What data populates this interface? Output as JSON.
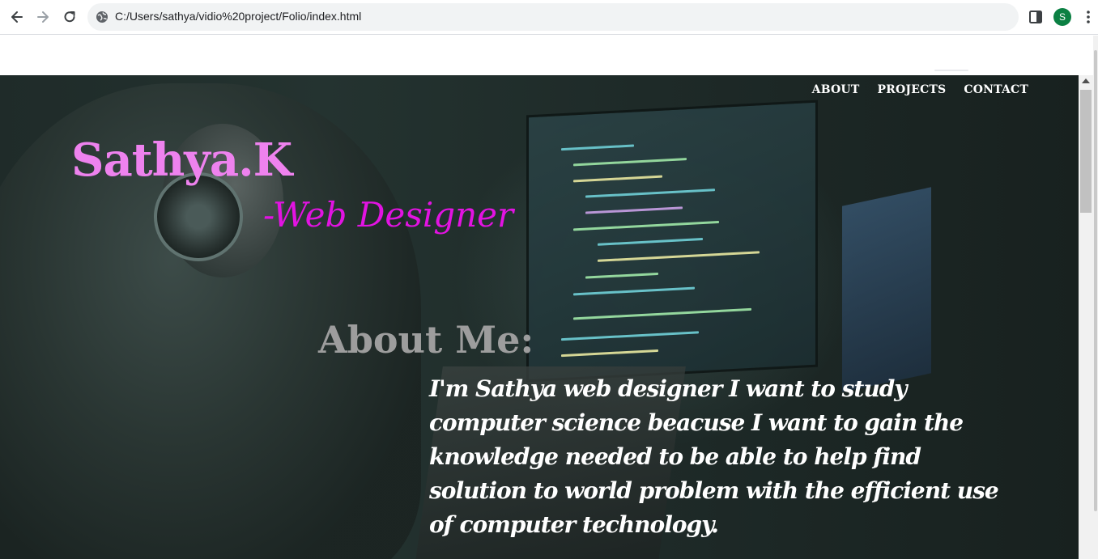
{
  "browser": {
    "url": "C:/Users/sathya/vidio%20project/Folio/index.html",
    "profile_initial": "S",
    "icons": {
      "back": "back-arrow-icon",
      "forward": "forward-arrow-icon",
      "reload": "reload-icon",
      "site_info": "site-info-icon",
      "side_panel": "side-panel-icon",
      "menu": "kebab-menu-icon"
    }
  },
  "page": {
    "nav": [
      "ABOUT",
      "PROJECTS",
      "CONTACT"
    ],
    "name": "Sathya.K",
    "role": "-Web Designer",
    "about_title": "About Me:",
    "about_body": "I'm Sathya web designer I want to study computer science beacuse I want to gain the knowledge needed to be able to help find solution to world problem with the efficient use of computer technology."
  },
  "colors": {
    "name": "#ee82ee",
    "role": "#e213e2",
    "about_title": "#9d9d9d",
    "avatar": "#0b8043"
  }
}
